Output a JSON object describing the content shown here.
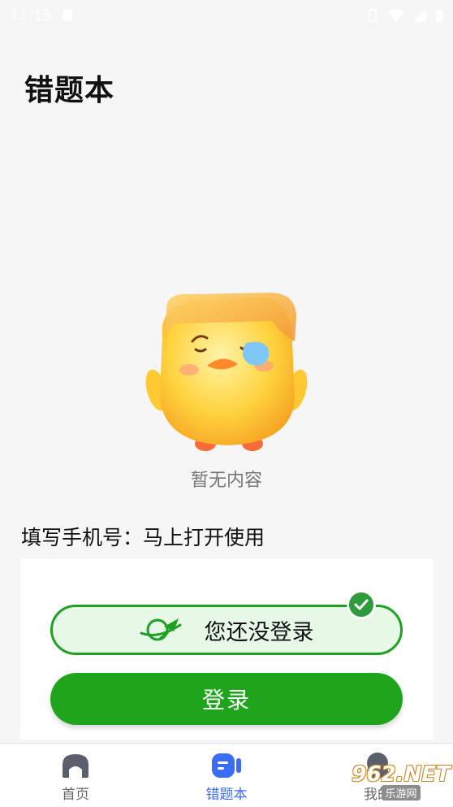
{
  "status_bar": {
    "time": "11:15"
  },
  "header": {
    "title": "错题本"
  },
  "empty_state": {
    "text": "暂无内容"
  },
  "prompt": {
    "text": "填写手机号：马上打开使用"
  },
  "login_card": {
    "status_text": "您还没登录",
    "login_button_label": "登录"
  },
  "tabs": [
    {
      "label": "首页",
      "icon": "home-icon",
      "active": false
    },
    {
      "label": "错题本",
      "icon": "notebook-icon",
      "active": true
    },
    {
      "label": "我的",
      "icon": "profile-icon",
      "active": false
    }
  ],
  "watermark": {
    "main": "962.NET",
    "sub": "乐游网"
  },
  "colors": {
    "accent_green": "#1ea51c",
    "active_tab_blue": "#3b6cf6",
    "background": "#f6f6f6"
  }
}
